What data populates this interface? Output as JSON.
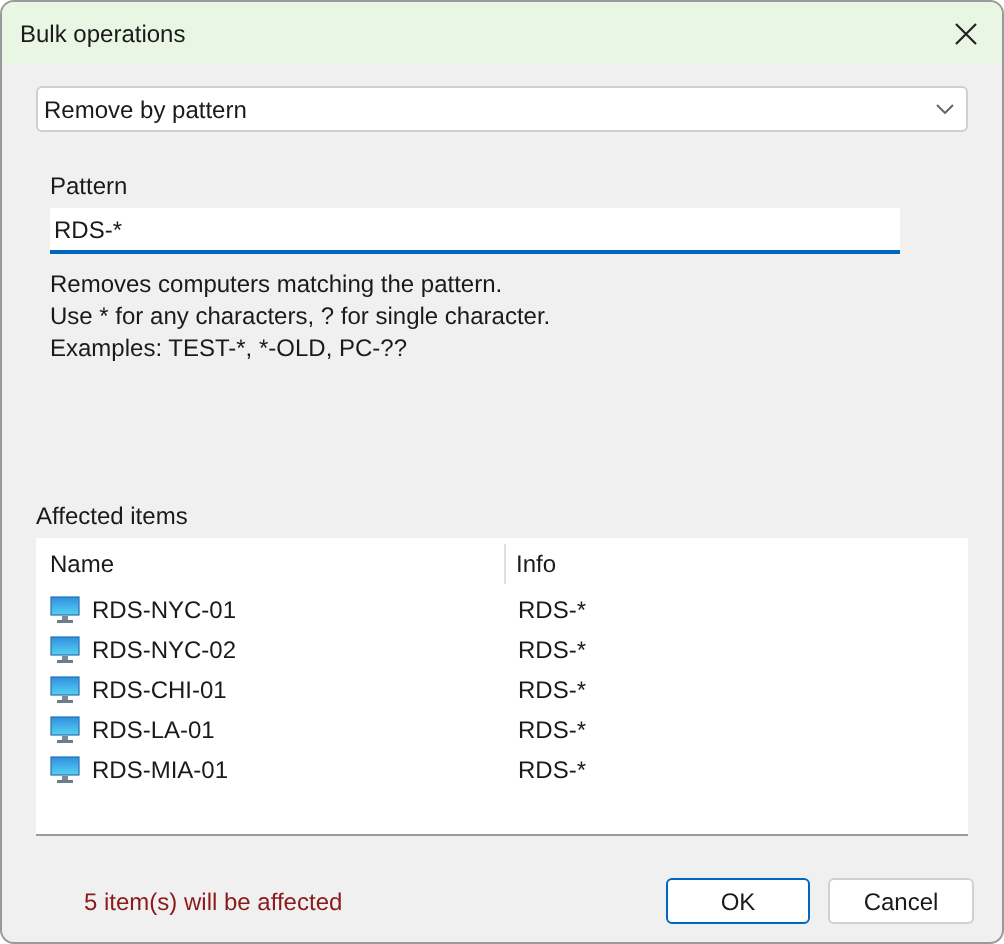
{
  "window": {
    "title": "Bulk operations"
  },
  "operation": {
    "value": "Remove by pattern"
  },
  "pattern": {
    "label": "Pattern",
    "value": "RDS-*"
  },
  "help": [
    "Removes computers matching the pattern.",
    "Use * for any characters, ? for single character.",
    "Examples: TEST-*, *-OLD, PC-??"
  ],
  "affected": {
    "label": "Affected items",
    "columns": [
      "Name",
      "Info"
    ],
    "rows": [
      {
        "name": "RDS-NYC-01",
        "info": "RDS-*"
      },
      {
        "name": "RDS-NYC-02",
        "info": "RDS-*"
      },
      {
        "name": "RDS-CHI-01",
        "info": "RDS-*"
      },
      {
        "name": "RDS-LA-01",
        "info": "RDS-*"
      },
      {
        "name": "RDS-MIA-01",
        "info": "RDS-*"
      }
    ]
  },
  "status": "5 item(s) will be affected",
  "buttons": [
    {
      "label": "OK",
      "kind": "default"
    },
    {
      "label": "Cancel",
      "kind": "normal"
    }
  ]
}
